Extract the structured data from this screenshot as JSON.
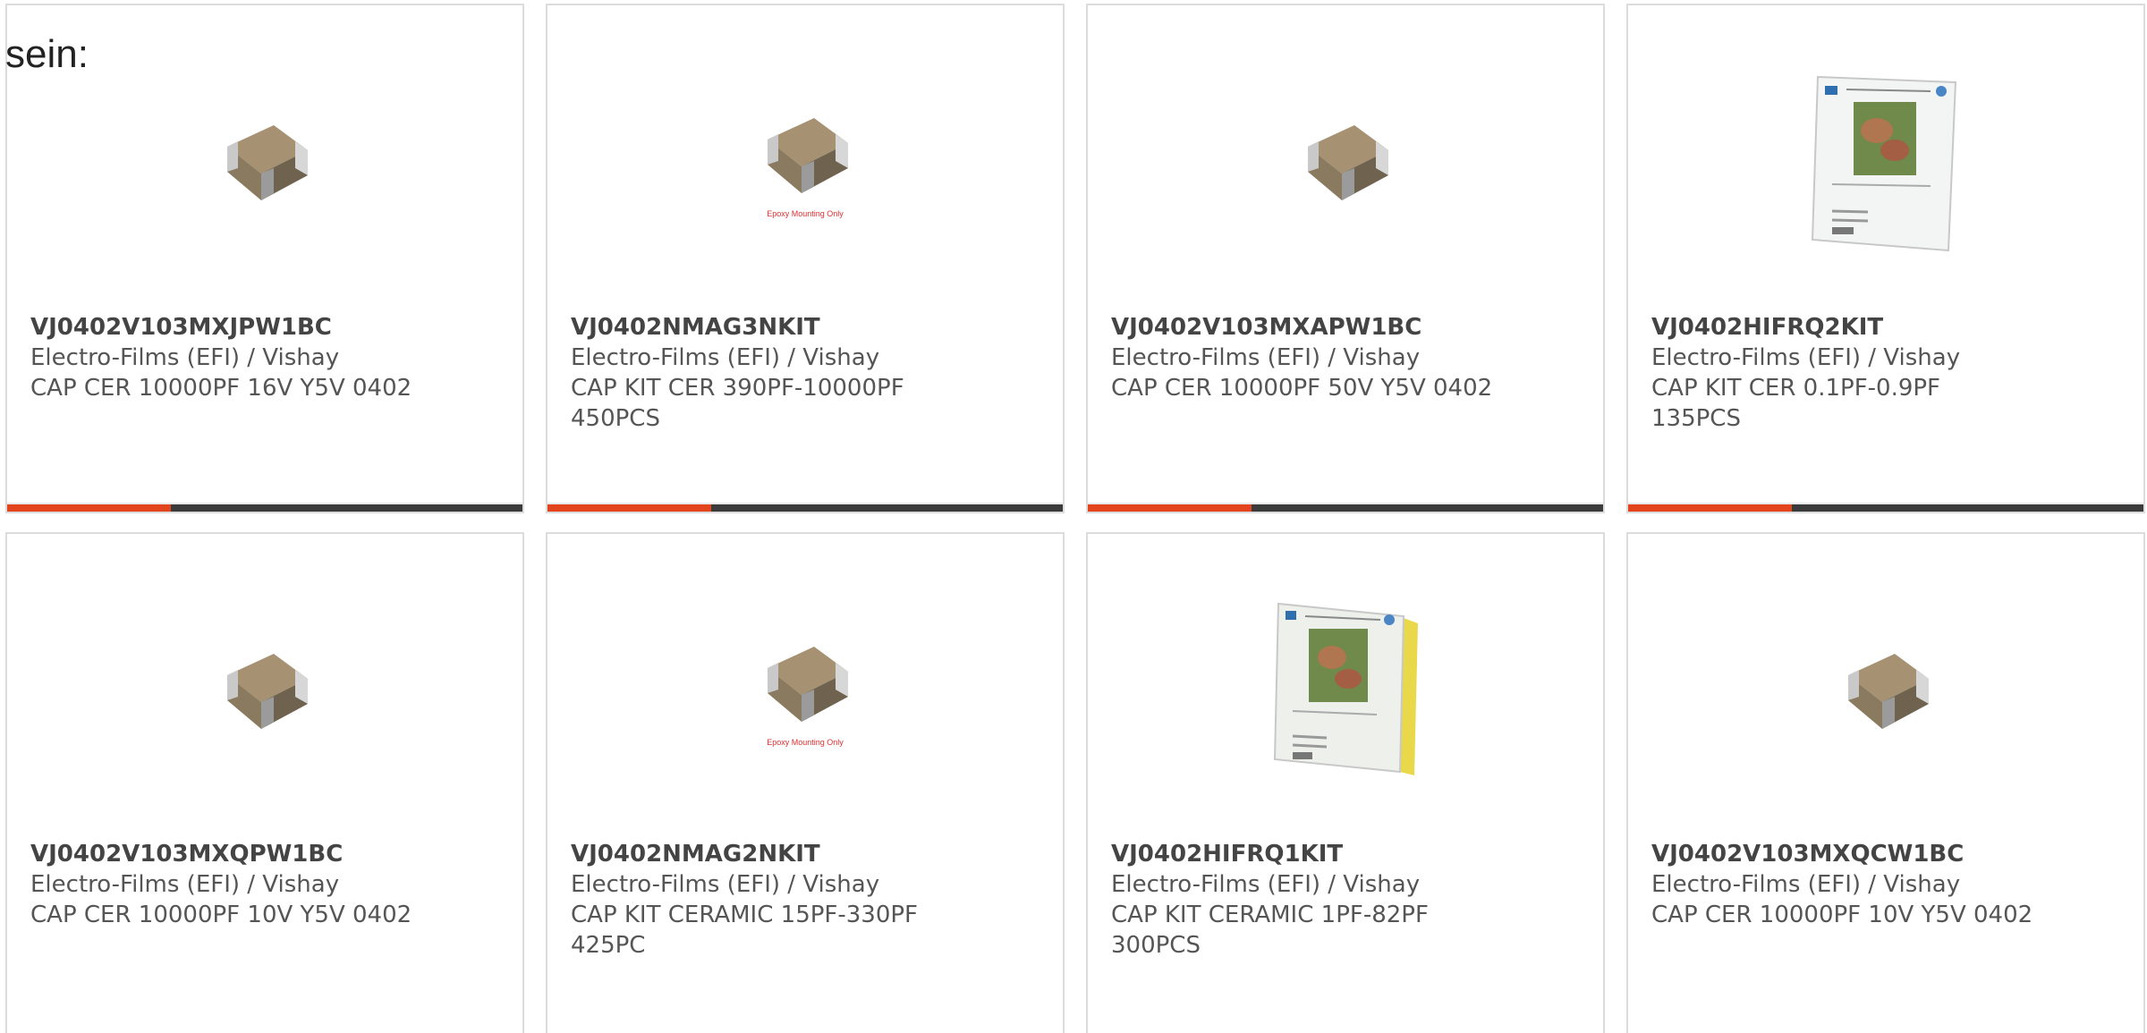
{
  "intro": "sein:",
  "products": [
    {
      "pn": "VJ0402V103MXJPW1BC",
      "mfr": "Electro-Films (EFI) / Vishay",
      "desc": "CAP CER 10000PF 16V Y5V 0402",
      "image": "chip-capacitor"
    },
    {
      "pn": "VJ0402NMAG3NKIT",
      "mfr": "Electro-Films (EFI) / Vishay",
      "desc": "CAP KIT CER 390PF-10000PF 450PCS",
      "image": "chip-capacitor-epoxy",
      "note": "Epoxy Mounting Only"
    },
    {
      "pn": "VJ0402V103MXAPW1BC",
      "mfr": "Electro-Films (EFI) / Vishay",
      "desc": "CAP CER 10000PF 50V Y5V 0402",
      "image": "chip-capacitor"
    },
    {
      "pn": "VJ0402HIFRQ2KIT",
      "mfr": "Electro-Films (EFI) / Vishay",
      "desc": "CAP KIT CER 0.1PF-0.9PF 135PCS",
      "image": "kit-booklet"
    },
    {
      "pn": "VJ0402V103MXQPW1BC",
      "mfr": "Electro-Films (EFI) / Vishay",
      "desc": "CAP CER 10000PF 10V Y5V 0402",
      "image": "chip-capacitor"
    },
    {
      "pn": "VJ0402NMAG2NKIT",
      "mfr": "Electro-Films (EFI) / Vishay",
      "desc": "CAP KIT CERAMIC 15PF-330PF 425PC",
      "image": "chip-capacitor-epoxy",
      "note": "Epoxy Mounting Only"
    },
    {
      "pn": "VJ0402HIFRQ1KIT",
      "mfr": "Electro-Films (EFI) / Vishay",
      "desc": "CAP KIT CERAMIC 1PF-82PF 300PCS",
      "image": "kit-booklet-yellow"
    },
    {
      "pn": "VJ0402V103MXQCW1BC",
      "mfr": "Electro-Films (EFI) / Vishay",
      "desc": "CAP CER 10000PF 10V Y5V 0402",
      "image": "chip-capacitor"
    }
  ],
  "colors": {
    "accent": "#e2441e",
    "bar": "#3b3b3b",
    "border": "#dcdcdc"
  }
}
